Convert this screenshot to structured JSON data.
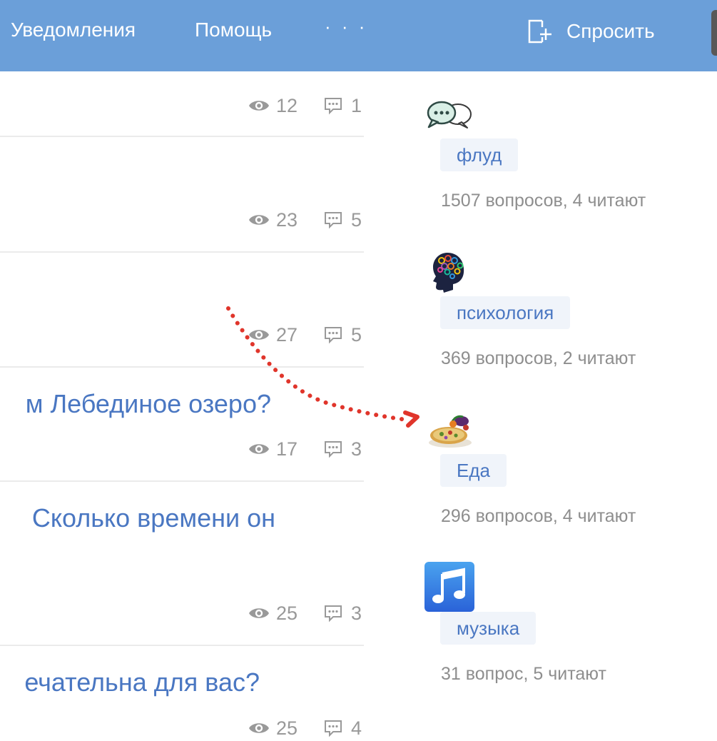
{
  "header": {
    "nav": [
      "Уведомления",
      "Помощь"
    ],
    "more": "· · ·",
    "ask_label": "Спросить"
  },
  "feed": {
    "questions": [
      {
        "title": "",
        "views": "12",
        "answers": "1"
      },
      {
        "title": "",
        "views": "23",
        "answers": "5"
      },
      {
        "title": "",
        "views": "27",
        "answers": "5"
      },
      {
        "title": "м Лебединое озеро?",
        "views": "17",
        "answers": "3"
      },
      {
        "title": "Сколько времени он",
        "views": "25",
        "answers": "3"
      },
      {
        "title": "ечательна для вас?",
        "views": "25",
        "answers": "4"
      }
    ]
  },
  "sidebar": {
    "topics": [
      {
        "name": "флуд",
        "meta": "1507 вопросов, 4 читают",
        "icon": "chat-bubbles-icon"
      },
      {
        "name": "психология",
        "meta": "369 вопросов, 2 читают",
        "icon": "head-profile-icon"
      },
      {
        "name": "Еда",
        "meta": "296 вопросов, 4 читают",
        "icon": "food-plate-icon"
      },
      {
        "name": "музыка",
        "meta": "31 вопрос, 5 читают",
        "icon": "music-note-icon"
      }
    ]
  },
  "colors": {
    "header_bg": "#6b9fd9",
    "link": "#4a77c2",
    "muted": "#999999",
    "tag_bg": "#f0f4fa",
    "arrow": "#e0352b"
  }
}
